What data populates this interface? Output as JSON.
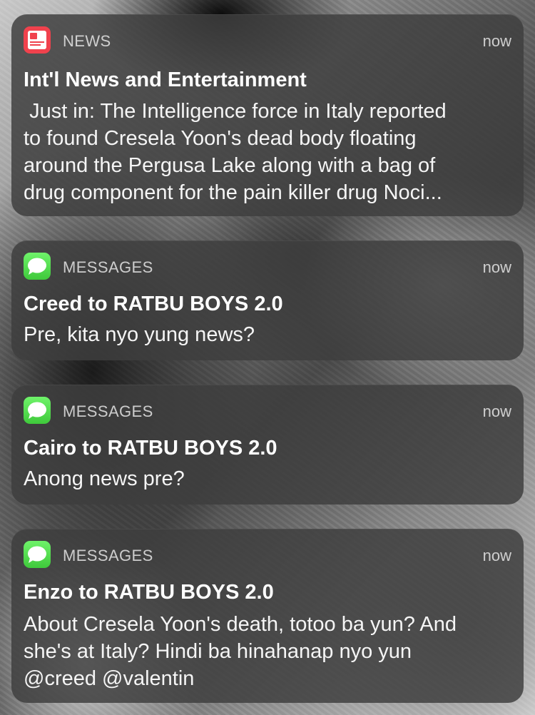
{
  "notifications": [
    {
      "app": "NEWS",
      "icon": "news-app-icon",
      "time": "now",
      "title": "Int'l News and Entertainment",
      "body": " Just in: The Intelligence force in Italy reported\nto found Cresela Yoon's dead body floating\naround the Pergusa Lake along with a bag of\ndrug component for the pain killer drug Noci..."
    },
    {
      "app": "MESSAGES",
      "icon": "messages-app-icon",
      "time": "now",
      "title": "Creed to RATBU BOYS 2.0",
      "body": "Pre, kita nyo yung news?"
    },
    {
      "app": "MESSAGES",
      "icon": "messages-app-icon",
      "time": "now",
      "title": "Cairo to RATBU BOYS 2.0",
      "body": "Anong news pre?"
    },
    {
      "app": "MESSAGES",
      "icon": "messages-app-icon",
      "time": "now",
      "title": "Enzo to RATBU BOYS 2.0",
      "body": "About Cresela Yoon's death, totoo ba yun? And\nshe's at Italy? Hindi ba hinahanap nyo yun\n@creed @valentin"
    }
  ],
  "colors": {
    "news_icon": "#f0424d",
    "messages_icon": "#4cd947",
    "card_bg": "rgba(62,62,62,0.84)"
  }
}
